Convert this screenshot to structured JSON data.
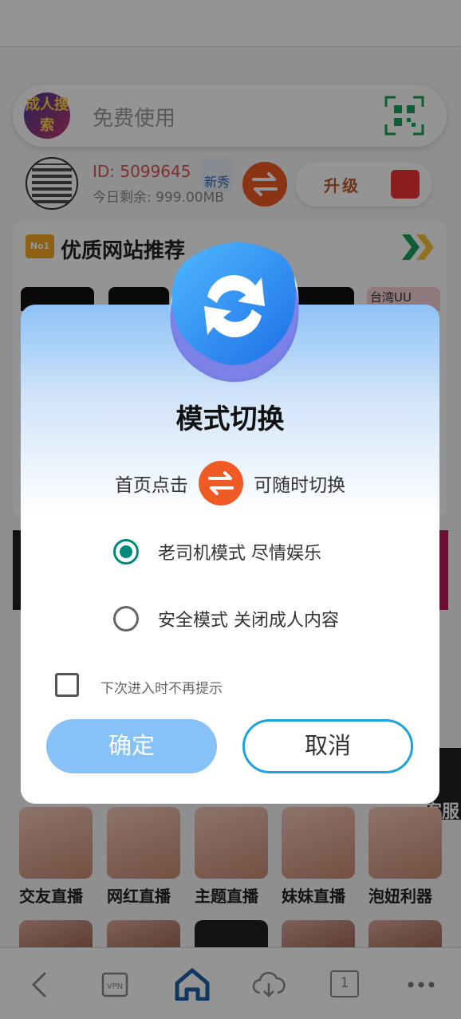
{
  "search": {
    "logo_text": "成人搜索",
    "placeholder": "免费使用"
  },
  "user": {
    "id": "ID: 5099645",
    "quota": "今日剩余: 999.00MB",
    "badge": "新秀",
    "upgrade_label": "升级"
  },
  "recommend": {
    "badge": "No1",
    "title": "优质网站推荐",
    "thumb_label": "台湾UU"
  },
  "live": {
    "items": [
      "交友直播",
      "网红直播",
      "主题直播",
      "妹妹直播",
      "泡妞利器"
    ]
  },
  "service": {
    "label": "客服"
  },
  "dialog": {
    "title": "模式切换",
    "hint_pre": "首页点击",
    "hint_post": "可随时切换",
    "options": [
      {
        "label": "老司机模式 尽情娱乐",
        "checked": true
      },
      {
        "label": "安全模式 关闭成人内容",
        "checked": false
      }
    ],
    "dont_remind_label": "下次进入时不再提示",
    "confirm_label": "确定",
    "cancel_label": "取消"
  },
  "nav": {
    "tabs_count": "1"
  },
  "colors": {
    "accent_orange": "#f05a24",
    "radio_teal": "#00897b",
    "confirm_blue": "#86c1f7",
    "cancel_border": "#1ba3dd"
  }
}
